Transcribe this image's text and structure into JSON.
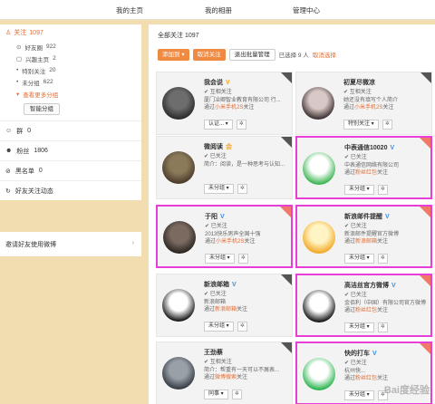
{
  "topnav": {
    "home": "我的主页",
    "album": "我的相册",
    "manage": "管理中心"
  },
  "sidebar": {
    "follow_label": "关注",
    "follow_count": "1097",
    "subs": [
      {
        "label": "好友圈",
        "count": "922"
      },
      {
        "label": "兴趣主页",
        "count": "2"
      },
      {
        "label": "特别关注",
        "count": "20"
      },
      {
        "label": "未分组",
        "count": "622"
      }
    ],
    "view_more": "查看更多分组",
    "smart_group": "智能分组",
    "groups_label": "群",
    "groups_count": "0",
    "fans_label": "粉丝",
    "fans_count": "1806",
    "blacklist_label": "黑名单",
    "blacklist_count": "0",
    "friend_dynamics": "好友关注动态",
    "invite": "邀请好友使用微博"
  },
  "main": {
    "title": "全部关注",
    "title_count": "1097",
    "add_to": "添加到",
    "unfollow": "取消关注",
    "batch_exit": "退出批量管理",
    "selected": "已选择 9 人",
    "cancel_select": "取消选择"
  },
  "cards": [
    {
      "name": "我会说",
      "badge": "V",
      "relation": "互相关注",
      "desc": "厦门冶卿智业教育有限公司 行...",
      "via_pre": "通过",
      "via_em": "小米手机2S",
      "via_post": "关注",
      "group": "认证...",
      "hl": false
    },
    {
      "name": "初夏尽微凉",
      "badge": "",
      "relation": "互相关注",
      "desc": "她还没有填写个人简介",
      "via_pre": "通过",
      "via_em": "小米手机2S",
      "via_post": "关注",
      "group": "特别关注",
      "hl": false
    },
    {
      "name": "微阅读",
      "badge": "会",
      "relation": "已关注",
      "desc": "简介：阅读，是一种思考与认知...",
      "via_pre": "",
      "via_em": "",
      "via_post": "",
      "group": "未分组",
      "hl": false
    },
    {
      "name": "中表通信10020",
      "badge": "V",
      "relation": "已关注",
      "desc": "中表通信网络有限公司",
      "via_pre": "通过",
      "via_em": "粉丝红包",
      "via_post": "关注",
      "group": "未分组",
      "hl": true
    },
    {
      "name": "于阳",
      "badge": "V",
      "relation": "已关注",
      "desc": "2013快乐男声全国十强",
      "via_pre": "通过",
      "via_em": "小米手机2S",
      "via_post": "关注",
      "group": "未分组",
      "hl": true
    },
    {
      "name": "新浪邮件提醒",
      "badge": "V",
      "relation": "已关注",
      "desc": "新浪邮件提醒官方微博",
      "via_pre": "通过",
      "via_em": "新浪邮箱",
      "via_post": "关注",
      "group": "未分组",
      "hl": true
    },
    {
      "name": "新浪邮箱",
      "badge": "V",
      "relation": "已关注",
      "desc": "新浪邮箱",
      "via_pre": "通过",
      "via_em": "新浪邮箱",
      "via_post": "关注",
      "group": "未分组",
      "hl": false
    },
    {
      "name": "高洁丝官方微博",
      "badge": "V",
      "relation": "已关注",
      "desc": "金佰利（中国）有限公司官方微博",
      "via_pre": "通过",
      "via_em": "粉丝红包",
      "via_post": "关注",
      "group": "未分组",
      "hl": true
    },
    {
      "name": "王劲蔡",
      "badge": "",
      "relation": "互相关注",
      "desc": "简介：帮重有一天可以不屑表...",
      "via_pre": "通过",
      "via_em": "微博搜索",
      "via_post": "关注",
      "group": "同事",
      "hl": false
    },
    {
      "name": "快的打车",
      "badge": "V",
      "relation": "已关注",
      "desc": "杭州快...",
      "via_pre": "通过",
      "via_em": "粉丝红包",
      "via_post": "关注",
      "group": "未分组",
      "hl": true
    }
  ],
  "watermark": "Bai度经验",
  "colors": {
    "accent": "#e36b31",
    "button": "#f08a42",
    "highlight": "#e83ed8",
    "background": "#f2ddb1"
  }
}
